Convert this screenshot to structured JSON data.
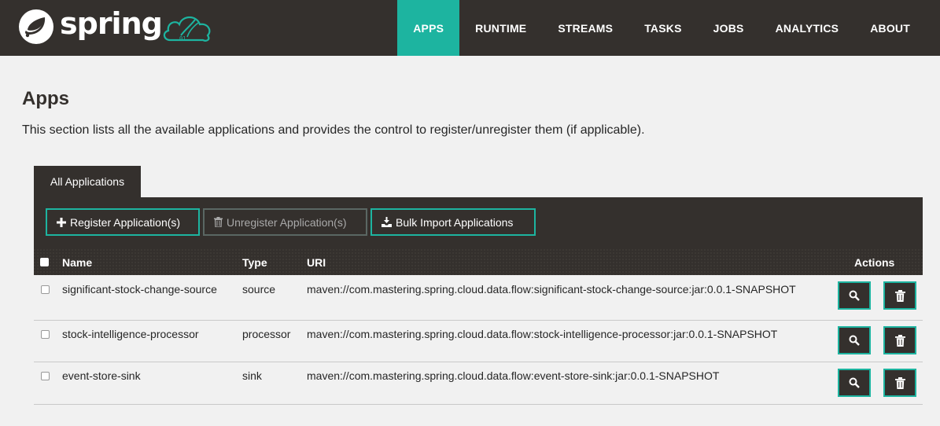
{
  "nav": {
    "brand": "spring",
    "items": [
      {
        "label": "APPS",
        "active": true
      },
      {
        "label": "RUNTIME",
        "active": false
      },
      {
        "label": "STREAMS",
        "active": false
      },
      {
        "label": "TASKS",
        "active": false
      },
      {
        "label": "JOBS",
        "active": false
      },
      {
        "label": "ANALYTICS",
        "active": false
      },
      {
        "label": "ABOUT",
        "active": false
      }
    ]
  },
  "page": {
    "title": "Apps",
    "description": "This section lists all the available applications and provides the control to register/unregister them (if applicable)."
  },
  "tabs": [
    {
      "label": "All Applications",
      "active": true
    }
  ],
  "toolbar": {
    "register": "Register Application(s)",
    "unregister": "Unregister Application(s)",
    "bulk_import": "Bulk Import Applications"
  },
  "table": {
    "columns": {
      "name": "Name",
      "type": "Type",
      "uri": "URI",
      "actions": "Actions"
    },
    "rows": [
      {
        "name": "significant-stock-change-source",
        "type": "source",
        "uri": "maven://com.mastering.spring.cloud.data.flow:significant-stock-change-source:jar:0.0.1-SNAPSHOT"
      },
      {
        "name": "stock-intelligence-processor",
        "type": "processor",
        "uri": "maven://com.mastering.spring.cloud.data.flow:stock-intelligence-processor:jar:0.0.1-SNAPSHOT"
      },
      {
        "name": "event-store-sink",
        "type": "sink",
        "uri": "maven://com.mastering.spring.cloud.data.flow:event-store-sink:jar:0.0.1-SNAPSHOT"
      }
    ]
  },
  "colors": {
    "accent": "#1db4a0",
    "dark": "#34302d",
    "background": "#f1f1f1"
  },
  "icons": {
    "register": "plus-icon",
    "unregister": "trash-icon",
    "bulk": "import-icon",
    "details": "search-icon",
    "delete": "trash-icon"
  }
}
